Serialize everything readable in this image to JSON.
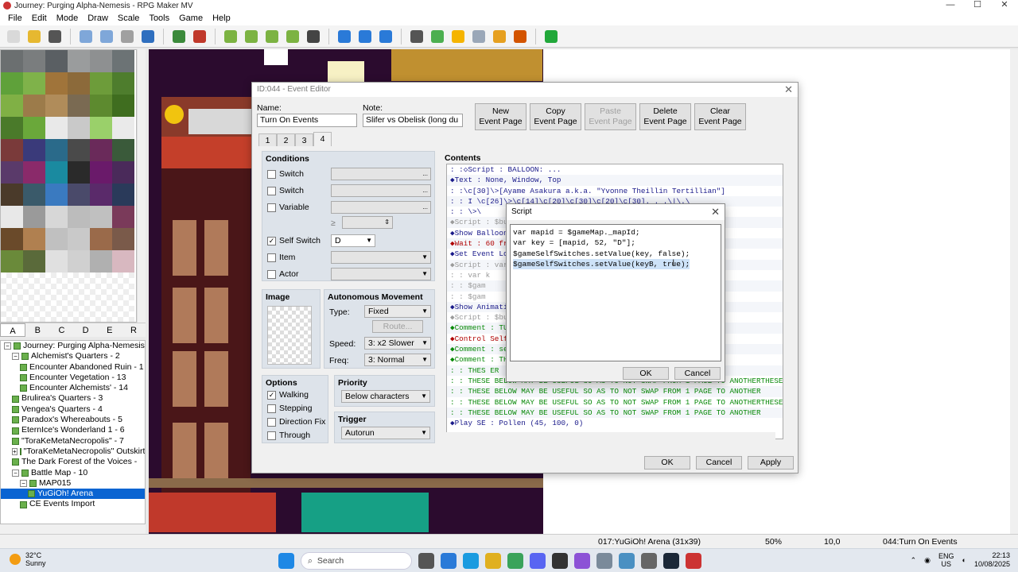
{
  "window": {
    "title": "Journey: Purging Alpha-Nemesis - RPG Maker MV",
    "min": "—",
    "max": "☐",
    "close": "✕"
  },
  "menu": [
    "File",
    "Edit",
    "Mode",
    "Draw",
    "Scale",
    "Tools",
    "Game",
    "Help"
  ],
  "toolbar_icons": [
    "new-project-icon",
    "open-project-icon",
    "save-project-icon",
    "cut-icon",
    "copy-icon",
    "paste-icon",
    "undo-icon",
    "map-mode-icon",
    "event-mode-icon",
    "pencil-icon",
    "rectangle-icon",
    "ellipse-icon",
    "fill-icon",
    "shadow-pen-icon",
    "zoom-in-icon",
    "zoom-out-icon",
    "zoom-actual-icon",
    "database-icon",
    "plugin-manager-icon",
    "sound-test-icon",
    "event-searcher-icon",
    "resource-manager-icon",
    "character-generator-icon",
    "playtest-icon"
  ],
  "palette_tabs": [
    "A",
    "B",
    "C",
    "D",
    "E",
    "R"
  ],
  "map_tree": [
    {
      "label": "Journey: Purging Alpha-Nemesis",
      "level": 0,
      "exp": "−"
    },
    {
      "label": "Alchemist's Quarters - 2",
      "level": 1,
      "exp": "−"
    },
    {
      "label": "Encounter Abandoned Ruin - 1",
      "level": 2,
      "exp": ""
    },
    {
      "label": "Encounter Vegetation - 13",
      "level": 2,
      "exp": ""
    },
    {
      "label": "Encounter Alchemists' - 14",
      "level": 2,
      "exp": ""
    },
    {
      "label": "Brulirea's Quarters - 3",
      "level": 1,
      "exp": ""
    },
    {
      "label": "Vengea's Quarters - 4",
      "level": 1,
      "exp": ""
    },
    {
      "label": "Paradox's Whereabouts - 5",
      "level": 1,
      "exp": ""
    },
    {
      "label": "EternIce's Wonderland 1 - 6",
      "level": 1,
      "exp": ""
    },
    {
      "label": "\"ToraKeMetaNecropolis\" - 7",
      "level": 1,
      "exp": ""
    },
    {
      "label": "\"ToraKeMetaNecropolis\" Outskirts",
      "level": 1,
      "exp": "+"
    },
    {
      "label": "The Dark Forest of the Voices -",
      "level": 1,
      "exp": ""
    },
    {
      "label": "Battle Map - 10",
      "level": 1,
      "exp": "−"
    },
    {
      "label": "MAP015",
      "level": 2,
      "exp": "−"
    },
    {
      "label": "YuGiOh! Arena",
      "level": 3,
      "exp": "",
      "selected": true
    },
    {
      "label": "CE Events Import",
      "level": 2,
      "exp": ""
    }
  ],
  "statusbar": {
    "map": "017:YuGiOh! Arena (31x39)",
    "zoom": "50%",
    "coords": "10,0",
    "event": "044:Turn On Events"
  },
  "taskbar": {
    "temp": "32°C",
    "weather": "Sunny",
    "search": "Search",
    "lang1": "ENG",
    "lang2": "US",
    "time": "22:13",
    "date": "10/08/2025"
  },
  "event_editor": {
    "title": "ID:044 - Event Editor",
    "name_label": "Name:",
    "name_value": "Turn On Events",
    "note_label": "Note:",
    "note_value": "Slifer vs Obelisk (long du",
    "buttons": {
      "new_page": [
        "New",
        "Event Page"
      ],
      "copy_page": [
        "Copy",
        "Event Page"
      ],
      "paste_page": [
        "Paste",
        "Event Page"
      ],
      "delete_page": [
        "Delete",
        "Event Page"
      ],
      "clear_page": [
        "Clear",
        "Event Page"
      ]
    },
    "page_tabs": [
      "1",
      "2",
      "3",
      "4"
    ],
    "conditions": {
      "title": "Conditions",
      "switch1": "Switch",
      "switch2": "Switch",
      "variable": "Variable",
      "ge": "≥",
      "self_switch": "Self Switch",
      "self_switch_value": "D",
      "item": "Item",
      "actor": "Actor",
      "ellipsis": "..."
    },
    "image": {
      "title": "Image"
    },
    "autonomous": {
      "title": "Autonomous Movement",
      "type_label": "Type:",
      "type_value": "Fixed",
      "route": "Route...",
      "speed_label": "Speed:",
      "speed_value": "3: x2 Slower",
      "freq_label": "Freq:",
      "freq_value": "3: Normal"
    },
    "options": {
      "title": "Options",
      "walking": "Walking",
      "stepping": "Stepping",
      "direction_fix": "Direction Fix",
      "through": "Through"
    },
    "priority": {
      "title": "Priority",
      "value": "Below characters"
    },
    "trigger": {
      "title": "Trigger",
      "value": "Autorun"
    },
    "contents_title": "Contents",
    "contents_lines": [
      {
        "text": ":            :◇Script : BALLOON: ...",
        "cls": "c-cmd"
      },
      {
        "text": "◆Text : None, Window, Top",
        "cls": "c-cmd"
      },
      {
        "text": ":      :\\c[30]\\>[Ayame Asakura a.k.a. \"Yvonne Theillin Tertillian\"]",
        "cls": "c-cmd"
      },
      {
        "text": ":      :   I \\c[26]\\>\\c[14]\\c[20]\\c[30]\\c[20]\\c[30]. . .\\|\\.\\",
        "cls": "c-cmd"
      },
      {
        "text": ":      :   \\>\\",
        "cls": "c-cmd"
      },
      {
        "text": "◆Script : $bus                                    _Tense[bust]'",
        "cls": "c-gray"
      },
      {
        "text": "◆Show Balloon",
        "cls": "c-cmd"
      },
      {
        "text": "◆Wait : 60 fram",
        "cls": "c-red"
      },
      {
        "text": "◆Set Event Loc",
        "cls": "c-cmd"
      },
      {
        "text": "◆Script : var m",
        "cls": "c-gray"
      },
      {
        "text": ":        : var k",
        "cls": "c-gray"
      },
      {
        "text": ":        : $gam",
        "cls": "c-gray"
      },
      {
        "text": ":        : $gam",
        "cls": "c-gray"
      },
      {
        "text": "◆Show Animatio",
        "cls": "c-cmd"
      },
      {
        "text": "◆Script : $bus",
        "cls": "c-gray"
      },
      {
        "text": "◆Comment : TURN",
        "cls": "c-green"
      },
      {
        "text": "◆Control Self",
        "cls": "c-red"
      },
      {
        "text": "◆Comment : sets",
        "cls": "c-green"
      },
      {
        "text": "◆Comment : THES                                   ANOTHERTHESE BELOW M",
        "cls": "c-green"
      },
      {
        "text": ":        : THES                                   ER",
        "cls": "c-green"
      },
      {
        "text": ":        : THESE BELOW MAY BE USEFUL SO AS TO NOT SWAP FROM 1 PAGE TO ANOTHERTHESE BELOW M",
        "cls": "c-green"
      },
      {
        "text": ":        : THESE BELOW MAY BE USEFUL SO AS TO NOT SWAP FROM 1 PAGE TO ANOTHER",
        "cls": "c-green"
      },
      {
        "text": ":        : THESE BELOW MAY BE USEFUL SO AS TO NOT SWAP FROM 1 PAGE TO ANOTHERTHESE BELOW M",
        "cls": "c-green"
      },
      {
        "text": ":        : THESE BELOW MAY BE USEFUL SO AS TO NOT SWAP FROM 1 PAGE TO ANOTHER",
        "cls": "c-green"
      },
      {
        "text": "◆Play SE : Pollen (45, 100, 0)",
        "cls": "c-cmd"
      }
    ],
    "ok": "OK",
    "cancel": "Cancel",
    "apply": "Apply"
  },
  "script_dialog": {
    "title": "Script",
    "lines": [
      "var mapid = $gameMap._mapId;",
      "var key = [mapid, 52, \"D\"];",
      "$gameSelfSwitches.setValue(key, false);",
      "$gameSelfSwitches.setValue(keyB, true);"
    ],
    "ok": "OK",
    "cancel": "Cancel"
  },
  "colors": {
    "accent": "#0a64d2",
    "panel": "#dde3ea",
    "map_bg": "#2b0b2e"
  }
}
